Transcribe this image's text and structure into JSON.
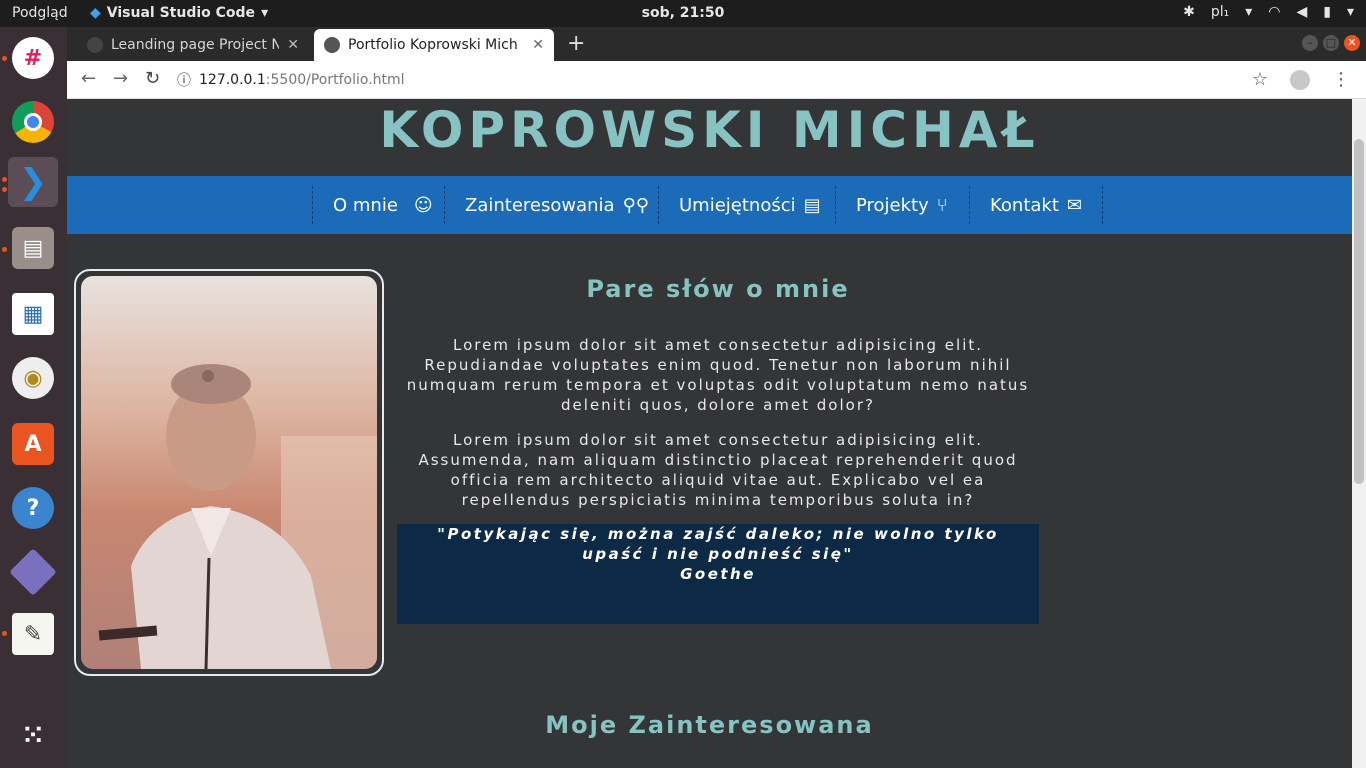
{
  "os_topbar": {
    "activities": "Podgląd",
    "app_menu": "Visual Studio Code",
    "clock": "sob, 21:50",
    "keyboard_layout": "pl₁"
  },
  "dock": {
    "items": [
      "slack",
      "chrome",
      "vscode",
      "files",
      "writer",
      "rhythmbox",
      "software-center",
      "help",
      "vm",
      "text-editor",
      "show-apps"
    ]
  },
  "browser": {
    "tabs": [
      {
        "title": "Leanding page Project No"
      },
      {
        "title": "Portfolio Koprowski Mich"
      }
    ],
    "url_host": "127.0.0.1",
    "url_path": ":5500/Portfolio.html"
  },
  "site": {
    "title": "KOPROWSKI MICHAŁ",
    "nav": [
      {
        "label": "O mnie",
        "icon": "user-astronaut-icon"
      },
      {
        "label": "Zainteresowania",
        "icon": "bicycle-icon"
      },
      {
        "label": "Umiejętności",
        "icon": "book-icon"
      },
      {
        "label": "Projekty",
        "icon": "code-branch-icon"
      },
      {
        "label": "Kontakt",
        "icon": "envelope-icon"
      }
    ],
    "about": {
      "heading": "Pare słów o mnie",
      "paragraph_1": "Lorem ipsum dolor sit amet consectetur adipisicing elit. Repudiandae voluptates enim quod. Tenetur non laborum nihil numquam rerum tempora et voluptas odit voluptatum nemo natus deleniti quos, dolore amet dolor?",
      "paragraph_2": "Lorem ipsum dolor sit amet consectetur adipisicing elit. Assumenda, nam aliquam distinctio placeat reprehenderit quod officia rem architecto aliquid vitae aut. Explicabo vel ea repellendus perspiciatis minima temporibus soluta in?",
      "quote": "\"Potykając się, można zajść daleko; nie wolno tylko upaść i nie podnieść się\"",
      "quote_author": "Goethe"
    },
    "interests_heading": "Moje Zainteresowana"
  },
  "colors": {
    "accent_teal": "#87c3c2",
    "nav_blue": "#1b6bb8",
    "quote_bg": "#0c2a45",
    "page_bg": "#333537"
  }
}
